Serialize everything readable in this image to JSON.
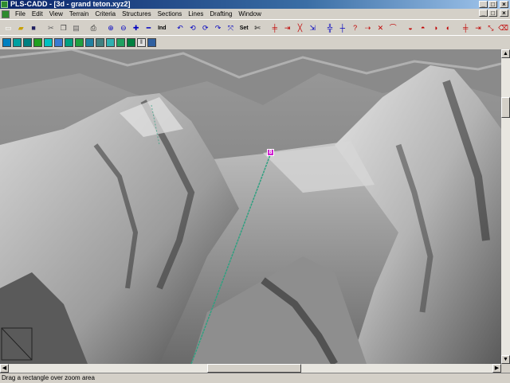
{
  "window": {
    "title": "PLS-CADD - [3d - grand teton.xyz2]",
    "minimize_glyph": "_",
    "maximize_glyph": "□",
    "close_glyph": "×"
  },
  "menu": [
    "File",
    "Edit",
    "View",
    "Terrain",
    "Criteria",
    "Structures",
    "Sections",
    "Lines",
    "Drafting",
    "Window"
  ],
  "toolbar1": [
    {
      "icon": "new-file-icon",
      "glyph": "▭",
      "color": "#ffffff"
    },
    {
      "icon": "open-folder-icon",
      "glyph": "▰",
      "color": "#c8a000"
    },
    {
      "icon": "save-icon",
      "glyph": "■",
      "color": "#202060"
    },
    {
      "sep": true
    },
    {
      "icon": "cut-icon",
      "glyph": "✂",
      "color": "#606060"
    },
    {
      "icon": "copy-icon",
      "glyph": "❐",
      "color": "#404040"
    },
    {
      "icon": "paste-icon",
      "glyph": "▤",
      "color": "#606060"
    },
    {
      "sep": true
    },
    {
      "icon": "print-icon",
      "glyph": "⎙",
      "color": "#202020"
    },
    {
      "sep": true
    },
    {
      "icon": "zoom-in-icon",
      "glyph": "⊕",
      "color": "#0000c0"
    },
    {
      "icon": "zoom-out-icon",
      "glyph": "⊖",
      "color": "#0000c0"
    },
    {
      "icon": "pan-plus-icon",
      "glyph": "✚",
      "color": "#0000c0"
    },
    {
      "icon": "pan-minus-icon",
      "glyph": "━",
      "color": "#0000c0"
    },
    {
      "icon": "zoom-indexed-icon",
      "glyph": "Ind",
      "color": "#000000",
      "small": true
    },
    {
      "sep": true
    },
    {
      "icon": "rotate-left-icon",
      "glyph": "↶",
      "color": "#0000c0"
    },
    {
      "icon": "rotate-up-icon",
      "glyph": "⟲",
      "color": "#0000c0"
    },
    {
      "icon": "rotate-down-icon",
      "glyph": "⟳",
      "color": "#0000c0"
    },
    {
      "icon": "rotate-right-icon",
      "glyph": "↷",
      "color": "#0000c0"
    },
    {
      "icon": "view-reset-icon",
      "glyph": "⤧",
      "color": "#0000c0"
    },
    {
      "icon": "set-view-icon",
      "glyph": "Set",
      "color": "#000000",
      "small": true
    },
    {
      "icon": "scissors-icon",
      "glyph": "✄",
      "color": "#000000"
    },
    {
      "sep": true
    },
    {
      "icon": "add-structure-icon",
      "glyph": "╪",
      "color": "#c00000"
    },
    {
      "icon": "move-structure-icon",
      "glyph": "⇥",
      "color": "#c00000"
    },
    {
      "icon": "delete-structure-icon",
      "glyph": "╳",
      "color": "#c00000"
    },
    {
      "icon": "structure-options-icon",
      "glyph": "⇲",
      "color": "#0000c0"
    },
    {
      "sep": true
    },
    {
      "icon": "add-pi-icon",
      "glyph": "╬",
      "color": "#0000c0"
    },
    {
      "icon": "pi-move-icon",
      "glyph": "┼",
      "color": "#0000c0"
    },
    {
      "icon": "pi-query-icon",
      "glyph": "?",
      "color": "#c00000"
    },
    {
      "icon": "pi-edit-icon",
      "glyph": "⇢",
      "color": "#c00000"
    },
    {
      "icon": "pi-delete-icon",
      "glyph": "✕",
      "color": "#c00000"
    },
    {
      "icon": "sag-icon",
      "glyph": "⌒",
      "color": "#c00000"
    },
    {
      "sep": true
    },
    {
      "icon": "section-add-icon",
      "glyph": "◒",
      "color": "#c00000"
    },
    {
      "icon": "section-move-icon",
      "glyph": "◓",
      "color": "#c00000"
    },
    {
      "icon": "section-query-icon",
      "glyph": "◑",
      "color": "#c00000"
    },
    {
      "icon": "section-delete-icon",
      "glyph": "◐",
      "color": "#c00000"
    },
    {
      "sep": true
    },
    {
      "icon": "wire-add-icon",
      "glyph": "╪",
      "color": "#c00000"
    },
    {
      "icon": "wire-move-icon",
      "glyph": "⇥",
      "color": "#c00000"
    },
    {
      "icon": "wire-query-icon",
      "glyph": "⤡",
      "color": "#c00000"
    },
    {
      "icon": "wire-delete-icon",
      "glyph": "⌫",
      "color": "#c00000"
    }
  ],
  "toolbar2": [
    {
      "icon": "display-profile-icon",
      "color": "#0080c0"
    },
    {
      "icon": "display-plan-icon",
      "color": "#00a0a0"
    },
    {
      "icon": "display-3d-icon",
      "color": "#008080"
    },
    {
      "icon": "display-tin-icon",
      "color": "#20a020"
    },
    {
      "icon": "display-contours-icon",
      "color": "#00c0c0"
    },
    {
      "icon": "display-features-icon",
      "color": "#3a7ad0"
    },
    {
      "icon": "display-points-icon",
      "color": "#00a080"
    },
    {
      "icon": "display-structures-icon",
      "color": "#20a040"
    },
    {
      "icon": "display-wires-icon",
      "color": "#2080a0"
    },
    {
      "icon": "display-clearances-icon",
      "color": "#408080"
    },
    {
      "icon": "display-sections-icon",
      "color": "#30b0b0"
    },
    {
      "icon": "display-map-icon",
      "color": "#20a060"
    },
    {
      "icon": "display-image-icon",
      "color": "#008040"
    },
    {
      "icon": "display-pause-icon",
      "color": "#202020",
      "glyph": "‖"
    },
    {
      "icon": "display-layers-icon",
      "color": "#3060a0"
    }
  ],
  "status": {
    "text": "Drag a rectangle over zoom area"
  },
  "scrollbar_glyphs": {
    "up": "▲",
    "down": "▼",
    "left": "◀",
    "right": "▶"
  },
  "marker": {
    "label": "8",
    "color": "#d020d0"
  },
  "line_color": "#30a080"
}
